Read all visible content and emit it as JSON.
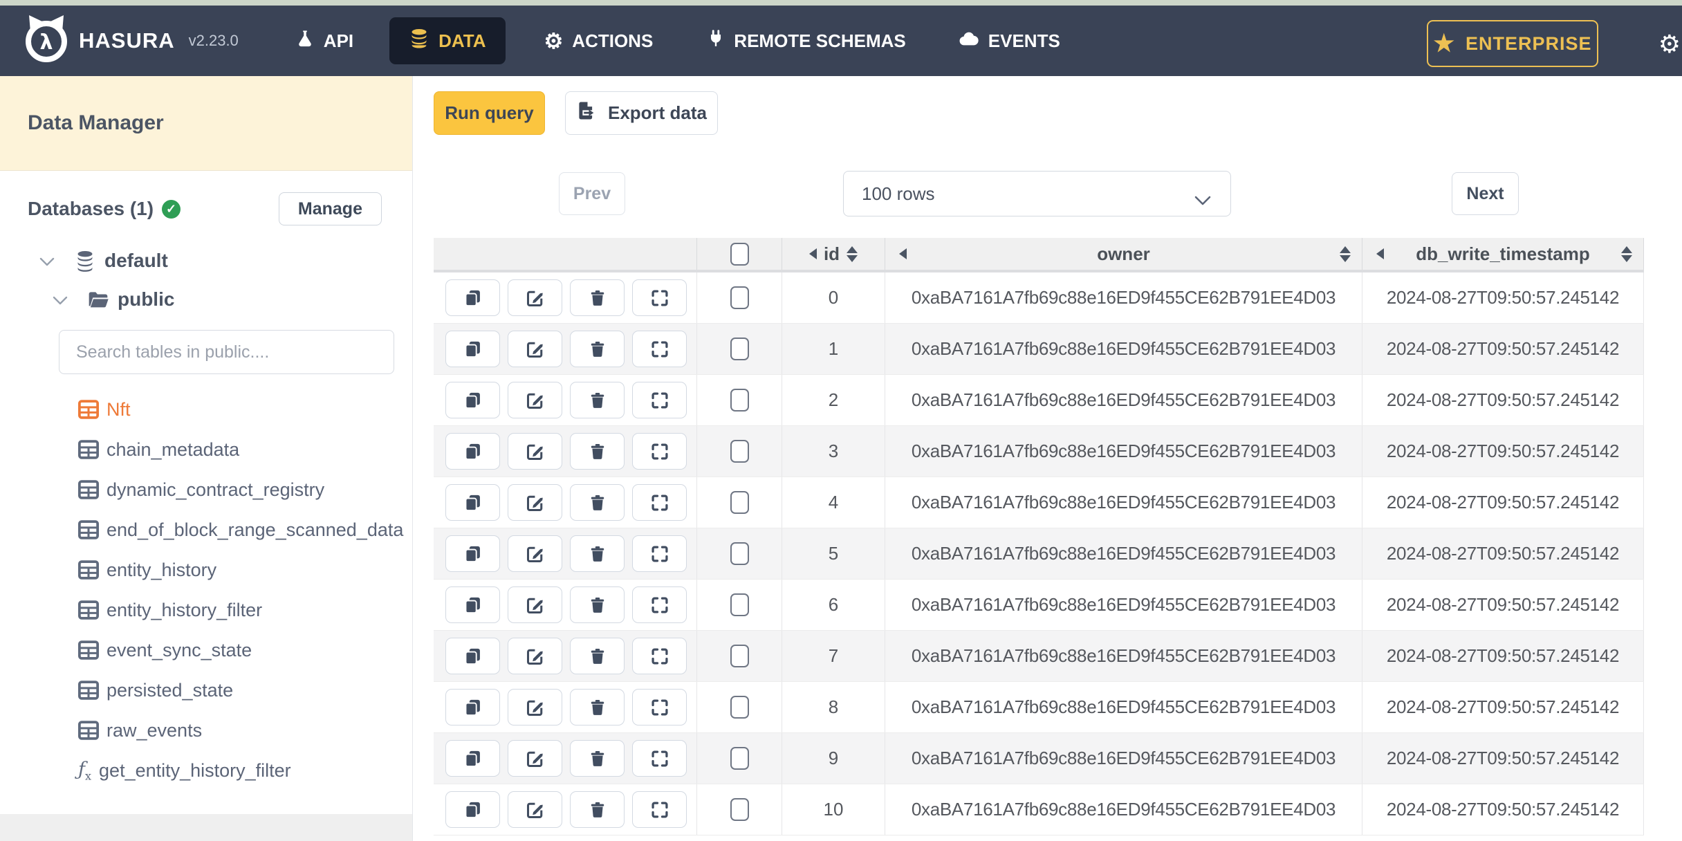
{
  "nav": {
    "brand": "HASURA",
    "version": "v2.23.0",
    "items": [
      {
        "label": "API",
        "icon": "flask-icon"
      },
      {
        "label": "DATA",
        "icon": "database-icon",
        "active": true
      },
      {
        "label": "ACTIONS",
        "icon": "gears-icon"
      },
      {
        "label": "REMOTE SCHEMAS",
        "icon": "plug-icon"
      },
      {
        "label": "EVENTS",
        "icon": "cloud-icon"
      }
    ],
    "enterprise_label": "ENTERPRISE",
    "colors": {
      "nav_bg": "#3a4356",
      "active_tab_bg": "#171d2b",
      "brand_yellow": "#edc053"
    }
  },
  "sidebar": {
    "title": "Data Manager",
    "databases_label": "Databases (1)",
    "manage_label": "Manage",
    "tree": {
      "database": "default",
      "schema": "public"
    },
    "search_placeholder": "Search tables in public....",
    "tables": [
      "Nft",
      "chain_metadata",
      "dynamic_contract_registry",
      "end_of_block_range_scanned_data",
      "entity_history",
      "entity_history_filter",
      "event_sync_state",
      "persisted_state",
      "raw_events"
    ],
    "selected_table": "Nft",
    "functions": [
      "get_entity_history_filter"
    ],
    "colors": {
      "header_bg": "#fdf3d9",
      "selected_orange": "#ee7a38",
      "check_green": "#2f9e55"
    }
  },
  "toolbar": {
    "run_query_label": "Run query",
    "export_data_label": "Export data",
    "run_query_bg": "#fbc53f"
  },
  "pagination": {
    "prev_label": "Prev",
    "rows_value": "100 rows",
    "next_label": "Next"
  },
  "table": {
    "columns": [
      "id",
      "owner",
      "db_write_timestamp"
    ],
    "row_actions": [
      "copy-icon",
      "edit-icon",
      "trash-icon",
      "expand-icon"
    ],
    "rows": [
      {
        "id": "0",
        "owner": "0xaBA7161A7fb69c88e16ED9f455CE62B791EE4D03",
        "db_write_timestamp": "2024-08-27T09:50:57.245142"
      },
      {
        "id": "1",
        "owner": "0xaBA7161A7fb69c88e16ED9f455CE62B791EE4D03",
        "db_write_timestamp": "2024-08-27T09:50:57.245142"
      },
      {
        "id": "2",
        "owner": "0xaBA7161A7fb69c88e16ED9f455CE62B791EE4D03",
        "db_write_timestamp": "2024-08-27T09:50:57.245142"
      },
      {
        "id": "3",
        "owner": "0xaBA7161A7fb69c88e16ED9f455CE62B791EE4D03",
        "db_write_timestamp": "2024-08-27T09:50:57.245142"
      },
      {
        "id": "4",
        "owner": "0xaBA7161A7fb69c88e16ED9f455CE62B791EE4D03",
        "db_write_timestamp": "2024-08-27T09:50:57.245142"
      },
      {
        "id": "5",
        "owner": "0xaBA7161A7fb69c88e16ED9f455CE62B791EE4D03",
        "db_write_timestamp": "2024-08-27T09:50:57.245142"
      },
      {
        "id": "6",
        "owner": "0xaBA7161A7fb69c88e16ED9f455CE62B791EE4D03",
        "db_write_timestamp": "2024-08-27T09:50:57.245142"
      },
      {
        "id": "7",
        "owner": "0xaBA7161A7fb69c88e16ED9f455CE62B791EE4D03",
        "db_write_timestamp": "2024-08-27T09:50:57.245142"
      },
      {
        "id": "8",
        "owner": "0xaBA7161A7fb69c88e16ED9f455CE62B791EE4D03",
        "db_write_timestamp": "2024-08-27T09:50:57.245142"
      },
      {
        "id": "9",
        "owner": "0xaBA7161A7fb69c88e16ED9f455CE62B791EE4D03",
        "db_write_timestamp": "2024-08-27T09:50:57.245142"
      },
      {
        "id": "10",
        "owner": "0xaBA7161A7fb69c88e16ED9f455CE62B791EE4D03",
        "db_write_timestamp": "2024-08-27T09:50:57.245142"
      }
    ]
  }
}
